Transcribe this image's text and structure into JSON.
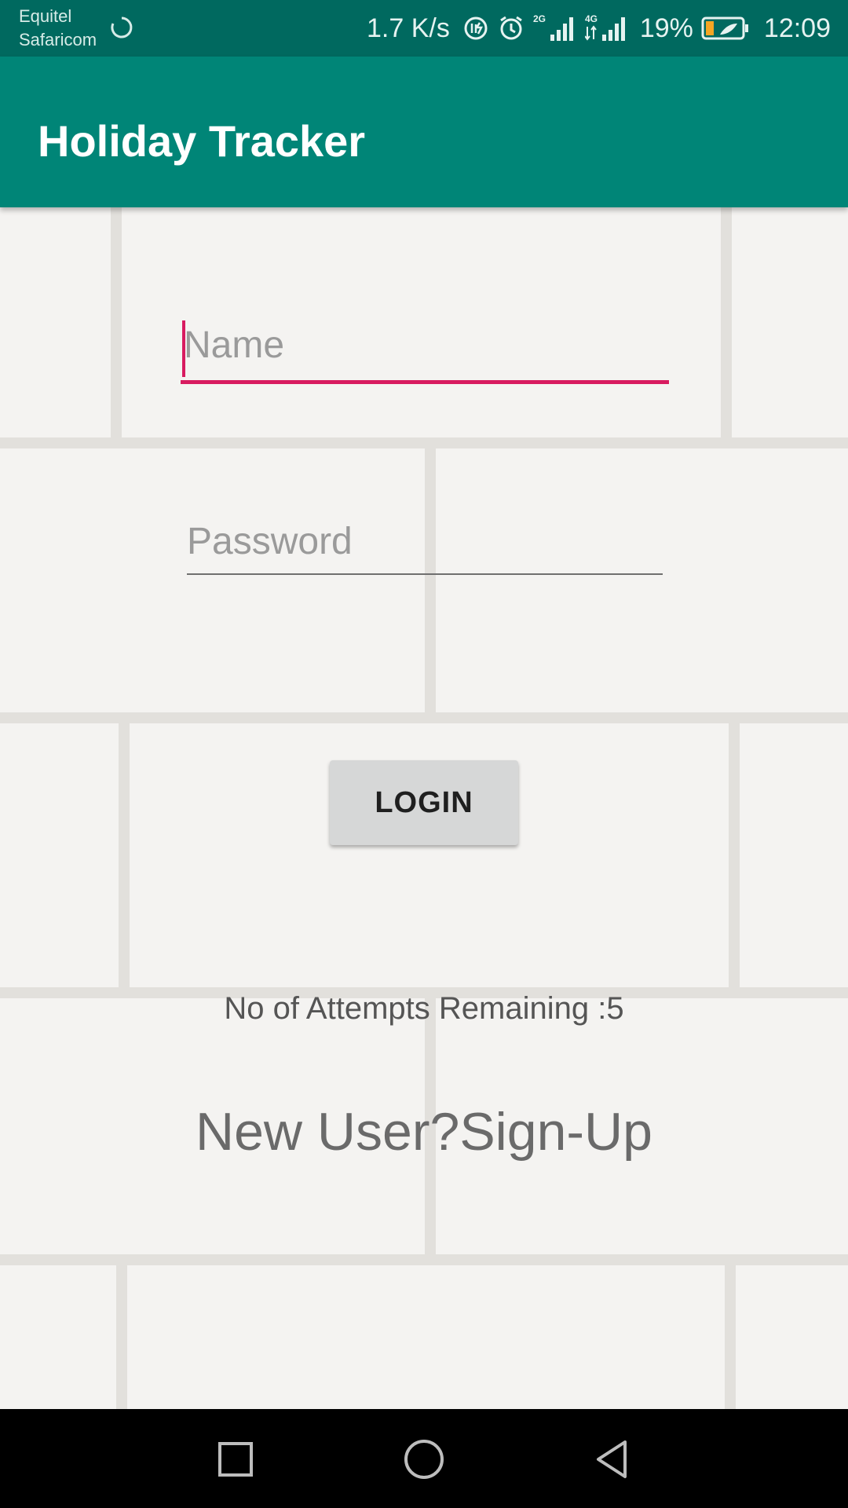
{
  "status_bar": {
    "carrier_line1": "Equitel",
    "carrier_line2": "Safaricom",
    "net_speed": "1.7 K/s",
    "signal1_label": "2G",
    "signal2_label": "4G",
    "battery": "19%",
    "time": "12:09",
    "icons": [
      "sync-icon",
      "data-saver-icon",
      "alarm-icon",
      "signal-2g-icon",
      "signal-4g-icon",
      "battery-icon"
    ]
  },
  "app_bar": {
    "title": "Holiday Tracker"
  },
  "form": {
    "name_placeholder": "Name",
    "password_placeholder": "Password",
    "login_label": "LOGIN"
  },
  "attempts_text": "No of Attempts Remaining :5",
  "signup_text": "New User?Sign-Up",
  "nav": {
    "icons": [
      "recents-square-icon",
      "home-circle-icon",
      "back-triangle-icon"
    ]
  },
  "colors": {
    "status_bar": "#00695f",
    "app_bar": "#008577",
    "accent": "#d81b60"
  }
}
